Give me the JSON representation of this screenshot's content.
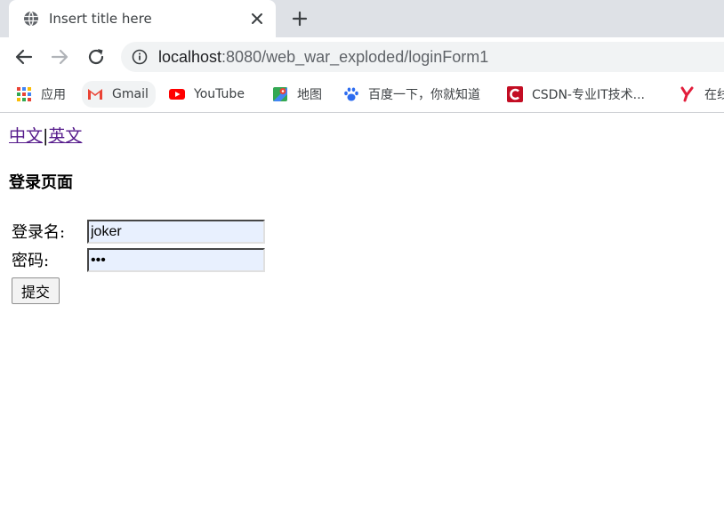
{
  "browser": {
    "tab": {
      "title": "Insert title here"
    },
    "address_bar": {
      "url_host": "localhost",
      "url_path": ":8080/web_war_exploded/loginForm1"
    },
    "bookmarks": [
      {
        "label": "应用",
        "icon": "apps-grid-icon"
      },
      {
        "label": "Gmail",
        "icon": "gmail-icon"
      },
      {
        "label": "YouTube",
        "icon": "youtube-icon"
      },
      {
        "label": "地图",
        "icon": "maps-icon"
      },
      {
        "label": "百度一下，你就知道",
        "icon": "baidu-icon"
      },
      {
        "label": "CSDN-专业IT技术...",
        "icon": "csdn-icon"
      },
      {
        "label": "在线",
        "icon": "y-icon"
      }
    ]
  },
  "page": {
    "lang_links": {
      "chinese": "中文",
      "separator": "|",
      "english": "英文"
    },
    "title": "登录页面",
    "form": {
      "username_label": "登录名:",
      "username_value": "joker",
      "password_label": "密码:",
      "password_value": "•••",
      "submit_label": "提交"
    }
  },
  "colors": {
    "visited_link": "#551a8b",
    "autofill_bg": "#e8f0fe",
    "tabstrip_bg": "#dee1e6"
  }
}
